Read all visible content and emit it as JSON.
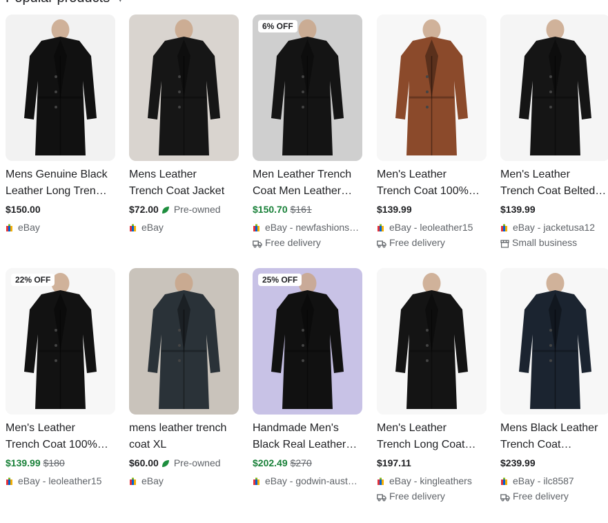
{
  "section": {
    "title": "Popular products",
    "chevron_icon": "chevron-down-icon"
  },
  "colors": {
    "sale": "#188038",
    "text": "#202124",
    "muted": "#5f6368",
    "leaf": "#1e8e3e"
  },
  "products": [
    {
      "title1": "Mens Genuine Black",
      "title2": "Leather Long Tren…",
      "price": "$150.00",
      "old_price": "",
      "condition": "",
      "seller": "eBay",
      "extra": "",
      "extra_icon": "",
      "badge": "",
      "coat_color": "#111111",
      "bg": "#f2f2f2"
    },
    {
      "title1": "Mens Leather",
      "title2": "Trench Coat Jacket",
      "price": "$72.00",
      "old_price": "",
      "condition": "Pre-owned",
      "seller": "eBay",
      "extra": "",
      "extra_icon": "",
      "badge": "",
      "coat_color": "#161616",
      "bg": "#d9d4cf"
    },
    {
      "title1": "Men Leather Trench",
      "title2": "Coat Men Leather…",
      "price": "$150.70",
      "old_price": "$161",
      "condition": "",
      "seller": "eBay - newfashions…",
      "extra": "Free delivery",
      "extra_icon": "truck-icon",
      "badge": "6% OFF",
      "coat_color": "#141414",
      "bg": "#cfcfcf"
    },
    {
      "title1": "Men's Leather",
      "title2": "Trench Coat 100%…",
      "price": "$139.99",
      "old_price": "",
      "condition": "",
      "seller": "eBay - leoleather15",
      "extra": "Free delivery",
      "extra_icon": "truck-icon",
      "badge": "",
      "coat_color": "#8b4a2b",
      "bg": "#f7f7f7"
    },
    {
      "title1": "Men's Leather",
      "title2": "Trench Coat Belted…",
      "price": "$139.99",
      "old_price": "",
      "condition": "",
      "seller": "eBay - jacketusa12",
      "extra": "Small business",
      "extra_icon": "storefront-icon",
      "badge": "",
      "coat_color": "#151515",
      "bg": "#f5f5f5"
    },
    {
      "title1": "Men's Leather",
      "title2": "Trench Coat 100%…",
      "price": "$139.99",
      "old_price": "$180",
      "condition": "",
      "seller": "eBay - leoleather15",
      "extra": "",
      "extra_icon": "",
      "badge": "22% OFF",
      "coat_color": "#121212",
      "bg": "#f7f7f7"
    },
    {
      "title1": "mens leather trench",
      "title2": "coat XL",
      "price": "$60.00",
      "old_price": "",
      "condition": "Pre-owned",
      "seller": "eBay",
      "extra": "",
      "extra_icon": "",
      "badge": "",
      "coat_color": "#2a3238",
      "bg": "#c9c3bb"
    },
    {
      "title1": "Handmade Men's",
      "title2": "Black Real Leather…",
      "price": "$202.49",
      "old_price": "$270",
      "condition": "",
      "seller": "eBay - godwin-aust…",
      "extra": "",
      "extra_icon": "",
      "badge": "25% OFF",
      "coat_color": "#111111",
      "bg": "#c8c2e6"
    },
    {
      "title1": "Men's Leather",
      "title2": "Trench Long Coat…",
      "price": "$197.11",
      "old_price": "",
      "condition": "",
      "seller": "eBay - kingleathers",
      "extra": "Free delivery",
      "extra_icon": "truck-icon",
      "badge": "",
      "coat_color": "#141414",
      "bg": "#f7f7f7"
    },
    {
      "title1": "Mens Black Leather",
      "title2": "Trench Coat…",
      "price": "$239.99",
      "old_price": "",
      "condition": "",
      "seller": "eBay - ilc8587",
      "extra": "Free delivery",
      "extra_icon": "truck-icon",
      "badge": "",
      "coat_color": "#1b2430",
      "bg": "#f7f7f7"
    }
  ]
}
